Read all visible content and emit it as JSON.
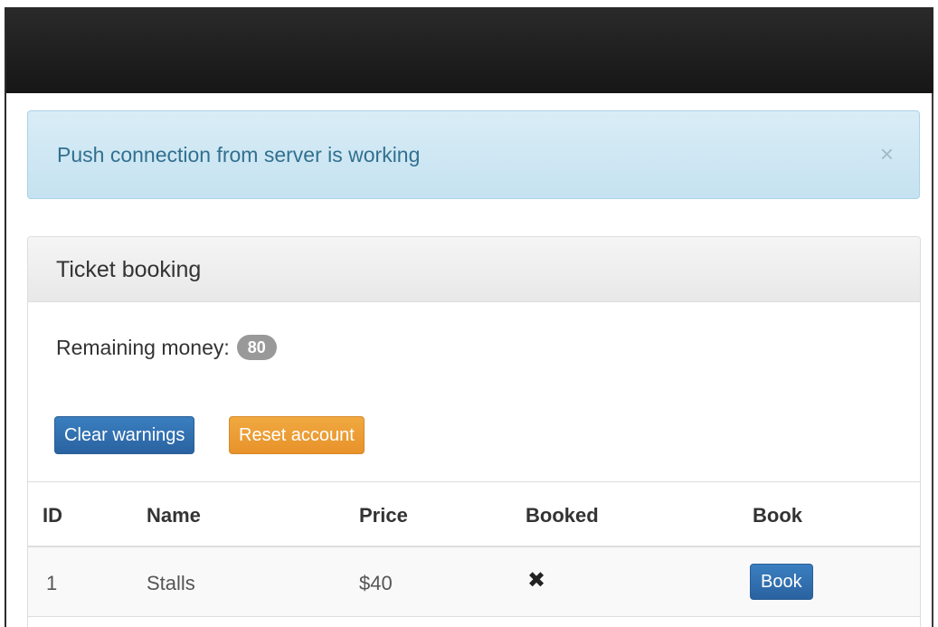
{
  "alert": {
    "message": "Push connection from server is working",
    "close_symbol": "×"
  },
  "panel": {
    "title": "Ticket booking",
    "remaining_label": "Remaining money:",
    "remaining_value": "80",
    "clear_button": "Clear warnings",
    "reset_button": "Reset account"
  },
  "table": {
    "headers": [
      "ID",
      "Name",
      "Price",
      "Booked",
      "Book"
    ],
    "rows": [
      {
        "id": "1",
        "name": "Stalls",
        "price": "$40",
        "booked_icon": "✖",
        "book_label": "Book"
      }
    ]
  },
  "colors": {
    "navbar": "#1f1f1f",
    "alert_bg": "#d9edf7",
    "alert_text": "#31708f",
    "primary": "#2f6fae",
    "warning": "#eea236",
    "badge": "#999999"
  },
  "icons": {
    "close": "close-icon",
    "booked": "cross-icon"
  }
}
